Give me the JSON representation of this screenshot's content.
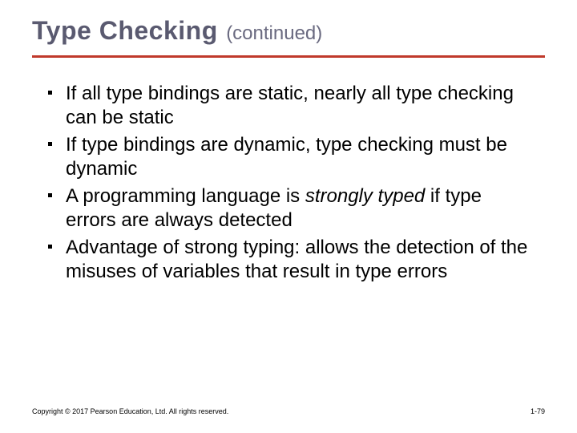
{
  "title": {
    "main": "Type Checking",
    "sub": "(continued)"
  },
  "bullets": [
    {
      "pre": "If all type bindings are static, nearly all type checking can be static",
      "em": "",
      "post": ""
    },
    {
      "pre": "If type bindings are dynamic, type checking must be dynamic",
      "em": "",
      "post": ""
    },
    {
      "pre": "A programming language is ",
      "em": "strongly typed",
      "post": " if type errors are always detected"
    },
    {
      "pre": "Advantage of strong typing: allows the detection of the misuses of variables that result in type errors",
      "em": "",
      "post": ""
    }
  ],
  "footer": {
    "copyright": "Copyright © 2017 Pearson Education, Ltd. All rights reserved.",
    "page": "1-79"
  }
}
